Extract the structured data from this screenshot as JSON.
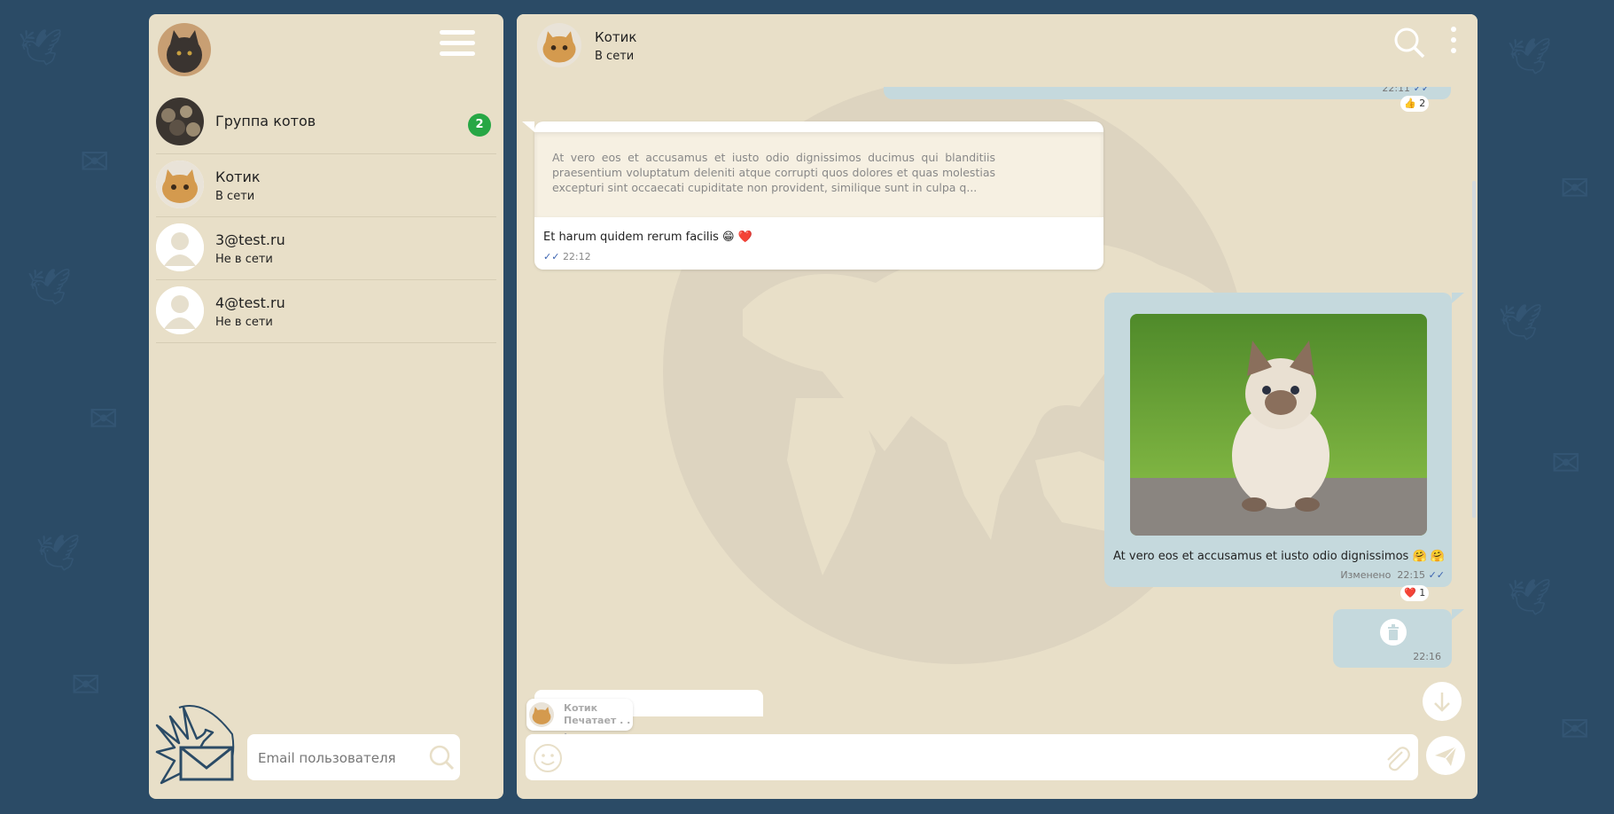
{
  "colors": {
    "page_bg": "#2b4b66",
    "panel_bg": "#e8dfc8",
    "outgoing_bubble": "#c5d9dd",
    "incoming_bubble": "#ffffff",
    "badge": "#27a745",
    "check_marks": "#3b63b0"
  },
  "sidebar": {
    "menu_icon": "hamburger-icon",
    "chats": [
      {
        "name": "Группа котов",
        "status": "",
        "unread": "2",
        "avatar": "group-photo"
      },
      {
        "name": "Котик",
        "status": "В сети",
        "unread": "",
        "avatar": "cat-photo"
      },
      {
        "name": "3@test.ru",
        "status": "Не в сети",
        "unread": "",
        "avatar": "default-user-icon"
      },
      {
        "name": "4@test.ru",
        "status": "Не в сети",
        "unread": "",
        "avatar": "default-user-icon"
      }
    ],
    "search": {
      "placeholder": "Email пользователя",
      "icon": "search-icon"
    }
  },
  "chat": {
    "header": {
      "name": "Котик",
      "status": "В сети"
    },
    "messages": {
      "top": {
        "time": "22:11",
        "reaction": "👍",
        "reaction_count": "2"
      },
      "reply": {
        "quote": "At vero eos et accusamus et iusto odio dignissimos ducimus qui blanditiis praesentium voluptatum deleniti atque corrupti quos dolores et quas molestias excepturi sint occaecati cupiditate non provident, similique sunt in culpa q...",
        "text": "Et harum quidem rerum facilis 😁 ❤️",
        "time": "22:12"
      },
      "image": {
        "caption": "At vero eos et accusamus et iusto odio dignissimos 🤗 🤗",
        "edited": "Изменено",
        "time": "22:15",
        "reaction": "❤️",
        "reaction_count": "1"
      },
      "deleted": {
        "time": "22:16",
        "icon": "trash-icon"
      }
    },
    "typing": {
      "name": "Котик",
      "status": "Печатает . . ."
    },
    "composer": {
      "placeholder": ""
    }
  }
}
